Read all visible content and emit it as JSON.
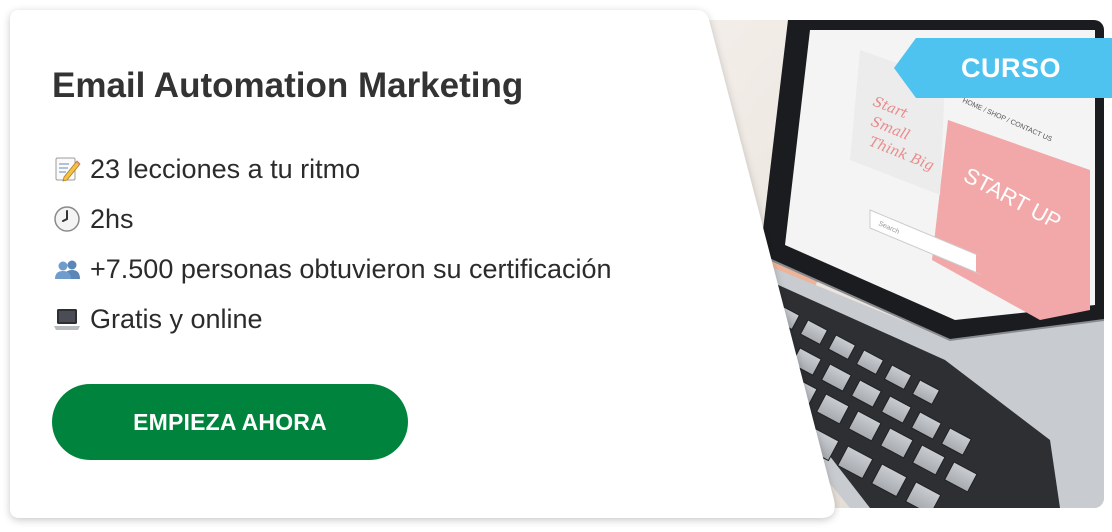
{
  "card": {
    "title": "Email Automation Marketing",
    "features": [
      {
        "icon": "memo-pencil-icon",
        "text": "23 lecciones a tu ritmo"
      },
      {
        "icon": "clock-icon",
        "text": "2hs"
      },
      {
        "icon": "people-icon",
        "text": "+7.500 personas obtuvieron su certificación"
      },
      {
        "icon": "laptop-icon",
        "text": "Gratis y online"
      }
    ],
    "cta_label": "EMPIEZA AHORA"
  },
  "badge": {
    "label": "CURSO"
  },
  "photo": {
    "screen_headline": "START UP",
    "screen_script": "Start Small Think Big",
    "screen_nav": "HOME / SHOP / CONTACT US",
    "screen_search": "Search"
  },
  "colors": {
    "cta": "#00843d",
    "badge": "#4fc3f0",
    "title": "#333333",
    "screen_pink": "#f2a8a8"
  }
}
